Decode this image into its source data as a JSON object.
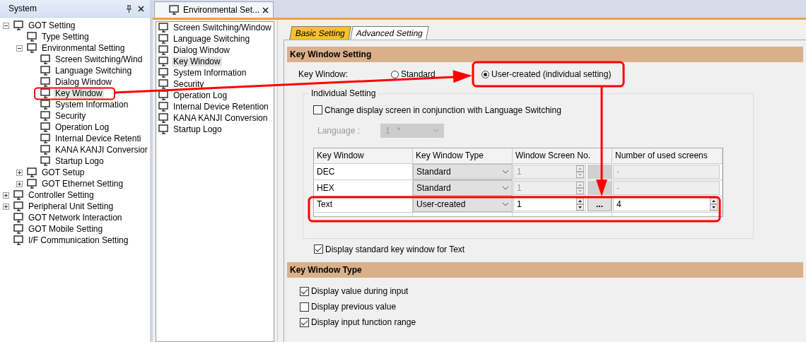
{
  "left_panel": {
    "title": "System",
    "tree": [
      {
        "label": "GOT Setting",
        "expanded": true,
        "selected": false,
        "children": [
          {
            "label": "Type Setting",
            "selected": false
          },
          {
            "label": "Environmental Setting",
            "expanded": true,
            "selected": false,
            "children": [
              {
                "label": "Screen Switching/Wind",
                "selected": false
              },
              {
                "label": "Language Switching",
                "selected": false
              },
              {
                "label": "Dialog Window",
                "selected": false
              },
              {
                "label": "Key Window",
                "selected": true
              },
              {
                "label": "System Information",
                "selected": false
              },
              {
                "label": "Security",
                "selected": false
              },
              {
                "label": "Operation Log",
                "selected": false
              },
              {
                "label": "Internal Device Retenti",
                "selected": false
              },
              {
                "label": "KANA KANJI Conversior",
                "selected": false
              },
              {
                "label": "Startup Logo",
                "selected": false
              }
            ]
          },
          {
            "label": "GOT Setup",
            "expanded": false,
            "selected": false
          },
          {
            "label": "GOT Ethernet Setting",
            "expanded": false,
            "selected": false
          }
        ]
      },
      {
        "label": "Controller Setting",
        "expanded": false,
        "selected": false
      },
      {
        "label": "Peripheral Unit Setting",
        "expanded": false,
        "selected": false
      },
      {
        "label": "GOT Network Interaction",
        "selected": false
      },
      {
        "label": "GOT Mobile Setting",
        "selected": false
      },
      {
        "label": "I/F Communication Setting",
        "selected": false
      }
    ]
  },
  "document_tab": {
    "label": "Environmental Set..."
  },
  "sublist": [
    {
      "label": "Screen Switching/Window",
      "selected": false
    },
    {
      "label": "Language Switching",
      "selected": false
    },
    {
      "label": "Dialog Window",
      "selected": false
    },
    {
      "label": "Key Window",
      "selected": true
    },
    {
      "label": "System Information",
      "selected": false
    },
    {
      "label": "Security",
      "selected": false
    },
    {
      "label": "Operation Log",
      "selected": false
    },
    {
      "label": "Internal Device Retention",
      "selected": false
    },
    {
      "label": "KANA KANJI Conversion",
      "selected": false
    },
    {
      "label": "Startup Logo",
      "selected": false
    }
  ],
  "setting_tabs": [
    {
      "label": "Basic Setting",
      "selected": true
    },
    {
      "label": "Advanced Setting",
      "selected": false
    }
  ],
  "key_window_setting": {
    "title": "Key Window Setting",
    "label": "Key Window:",
    "options": [
      {
        "label": "Standard",
        "selected": false
      },
      {
        "label": "User-created (individual setting)",
        "selected": true
      }
    ],
    "individual_setting": {
      "title": "Individual Setting",
      "language_switch": {
        "label": "Change display screen in conjunction with Language Switching",
        "checked": false
      },
      "language": {
        "label": "Language :",
        "value": "1   *",
        "disabled": true
      },
      "table": {
        "columns": [
          "Key Window",
          "Key Window Type",
          "Window Screen No.",
          "Number of used screens"
        ],
        "rows": [
          {
            "cells": [
              "DEC",
              "Standard",
              "1",
              "-"
            ],
            "disabled": true
          },
          {
            "cells": [
              "HEX",
              "Standard",
              "1",
              "-"
            ],
            "disabled": true
          },
          {
            "cells": [
              "Text",
              "User-created",
              "1",
              "4"
            ],
            "disabled": false,
            "browse": "..."
          }
        ]
      }
    },
    "standard_key_window": {
      "label": "Display standard key window for Text",
      "checked": true
    }
  },
  "key_window_type": {
    "title": "Key Window Type",
    "options": [
      {
        "label": "Display value during input",
        "checked": true
      },
      {
        "label": "Display previous value",
        "checked": false
      },
      {
        "label": "Display input function range",
        "checked": true
      }
    ]
  }
}
